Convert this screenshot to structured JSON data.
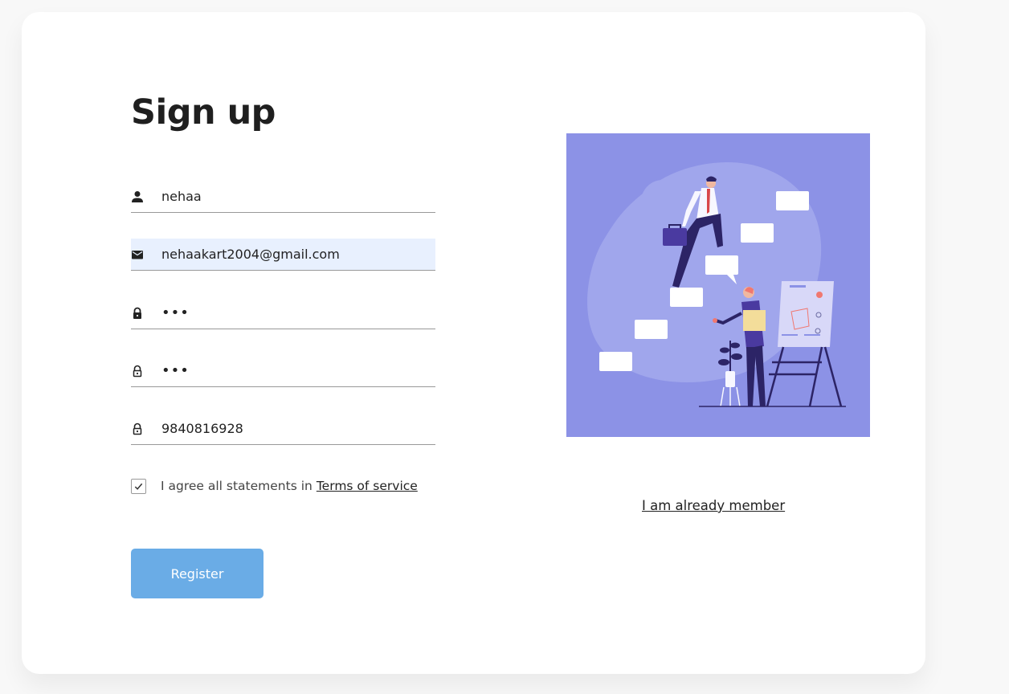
{
  "form": {
    "title": "Sign up",
    "name": {
      "value": "nehaa",
      "icon": "person-icon"
    },
    "email": {
      "value": "nehaakart2004@gmail.com",
      "icon": "envelope-icon"
    },
    "password": {
      "value": "•••",
      "icon": "lock-icon"
    },
    "confirm_password": {
      "value": "•••",
      "icon": "lock-outline-icon"
    },
    "phone": {
      "value": "9840816928",
      "icon": "lock-outline-icon"
    },
    "agree_text": "I agree all statements in",
    "terms_link": "Terms of service",
    "agree_checked": true,
    "register_label": "Register"
  },
  "side": {
    "illustration": "business-people-climbing-stairs-illustration",
    "member_link": "I am already member"
  },
  "colors": {
    "button": "#6aace6",
    "illustration_bg": "#8c92e6",
    "autofill_bg": "#e8f0fe"
  }
}
